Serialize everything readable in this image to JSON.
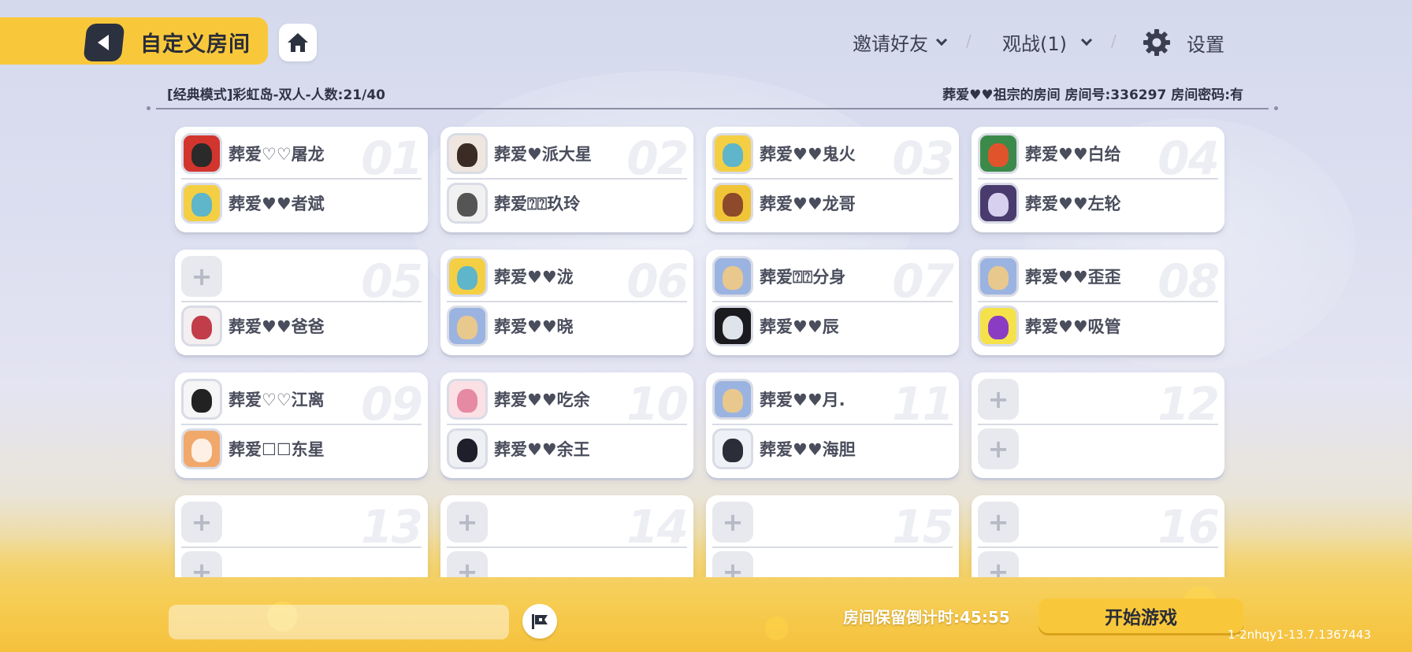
{
  "header": {
    "title": "自定义房间",
    "invite_label": "邀请好友",
    "spectate_label": "观战(1)",
    "settings_label": "设置"
  },
  "room": {
    "mode_info": "[经典模式]彩虹岛-双人-人数:21/40",
    "room_info": "葬爱♥♥祖宗的房间 房间号:336297 房间密码:有"
  },
  "teams": [
    {
      "num": "01",
      "players": [
        {
          "name": "葬爱♡♡屠龙",
          "avatar": "red-character-avatar"
        },
        {
          "name": "葬爱♥♥者斌",
          "avatar": "yellow-fish-avatar"
        }
      ]
    },
    {
      "num": "02",
      "players": [
        {
          "name": "葬爱♥派大星",
          "avatar": "girl-photo-avatar"
        },
        {
          "name": "葬爱⍰⍰玖玲",
          "avatar": "bw-photo-avatar"
        }
      ]
    },
    {
      "num": "03",
      "players": [
        {
          "name": "葬爱♥♥鬼火",
          "avatar": "yellow-fish-avatar"
        },
        {
          "name": "葬爱♥♥龙哥",
          "avatar": "brown-character-avatar"
        }
      ]
    },
    {
      "num": "04",
      "players": [
        {
          "name": "葬爱♥♥白给",
          "avatar": "green-duck-avatar"
        },
        {
          "name": "葬爱♥♥左轮",
          "avatar": "purple-robot-avatar"
        }
      ]
    },
    {
      "num": "05",
      "players": [
        {
          "name": "",
          "avatar": "empty"
        },
        {
          "name": "葬爱♥♥爸爸",
          "avatar": "clown-avatar"
        }
      ]
    },
    {
      "num": "06",
      "players": [
        {
          "name": "葬爱♥♥泷",
          "avatar": "yellow-fish-avatar"
        },
        {
          "name": "葬爱♥♥晓",
          "avatar": "bean-avatar"
        }
      ]
    },
    {
      "num": "07",
      "players": [
        {
          "name": "葬爱⍰⍰分身",
          "avatar": "bean-avatar"
        },
        {
          "name": "葬爱♥♥辰",
          "avatar": "dark-anime-avatar"
        }
      ]
    },
    {
      "num": "08",
      "players": [
        {
          "name": "葬爱♥♥歪歪",
          "avatar": "bean-avatar"
        },
        {
          "name": "葬爱♥♥吸管",
          "avatar": "purple-hat-avatar"
        }
      ]
    },
    {
      "num": "09",
      "players": [
        {
          "name": "葬爱♡♡江离",
          "avatar": "sketch-avatar"
        },
        {
          "name": "葬爱☐☐东星",
          "avatar": "bear-girl-avatar"
        }
      ]
    },
    {
      "num": "10",
      "players": [
        {
          "name": "葬爱♥♥吃余",
          "avatar": "pink-anime-avatar"
        },
        {
          "name": "葬爱♥♥余王",
          "avatar": "dark-hair-avatar"
        }
      ]
    },
    {
      "num": "11",
      "players": [
        {
          "name": "葬爱♥♥月.",
          "avatar": "bean-avatar"
        },
        {
          "name": "葬爱♥♥海胆",
          "avatar": "figure-avatar"
        }
      ]
    },
    {
      "num": "12",
      "players": [
        {
          "name": "",
          "avatar": "empty"
        },
        {
          "name": "",
          "avatar": "empty"
        }
      ]
    },
    {
      "num": "13",
      "players": [
        {
          "name": "",
          "avatar": "empty"
        },
        {
          "name": "",
          "avatar": "empty"
        }
      ]
    },
    {
      "num": "14",
      "players": [
        {
          "name": "",
          "avatar": "empty"
        },
        {
          "name": "",
          "avatar": "empty"
        }
      ]
    },
    {
      "num": "15",
      "players": [
        {
          "name": "",
          "avatar": "empty"
        },
        {
          "name": "",
          "avatar": "empty"
        }
      ]
    },
    {
      "num": "16",
      "players": [
        {
          "name": "",
          "avatar": "empty"
        },
        {
          "name": "",
          "avatar": "empty"
        }
      ]
    }
  ],
  "empty_slot_symbol": "+",
  "footer": {
    "countdown": "房间保留倒计时:45:55",
    "start_label": "开始游戏",
    "version": "1-2nhqy1-13.7.1367443"
  },
  "colors": {
    "accent_yellow": "#f9c83a",
    "dark_button": "#2c3140"
  }
}
